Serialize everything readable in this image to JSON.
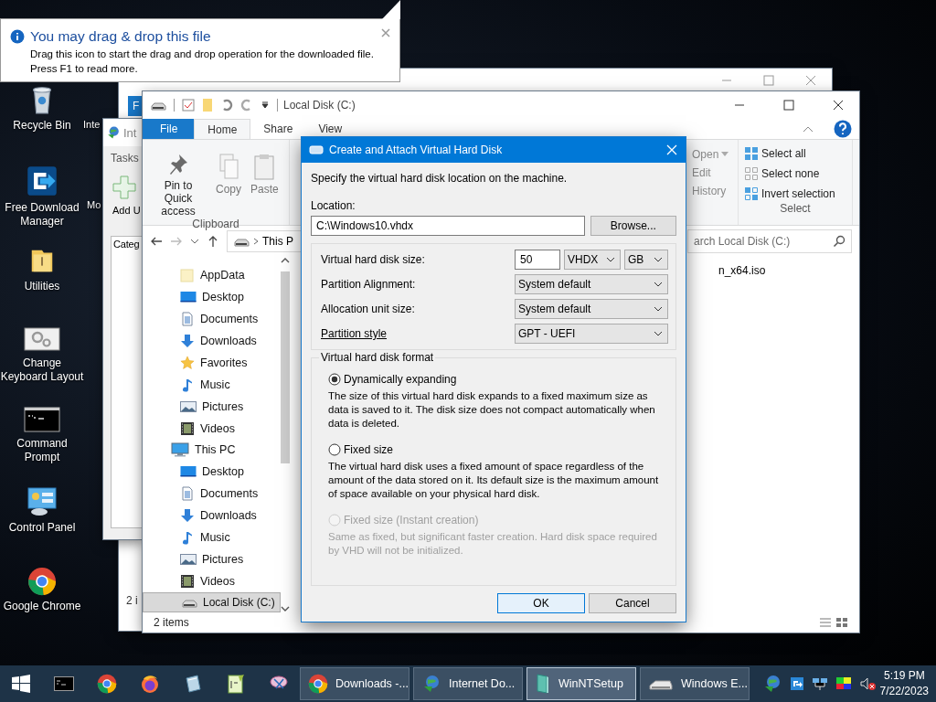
{
  "notification": {
    "title": "You may drag & drop this file",
    "message": "Drag this icon to start the drag and drop operation for the downloaded file.",
    "hint": "Press F1 to read more."
  },
  "desktop_icons": [
    {
      "label": "Recycle Bin",
      "kind": "recycle"
    },
    {
      "label": "Free Download Manager",
      "kind": "fdm"
    },
    {
      "label": "Utilities",
      "kind": "folder"
    },
    {
      "label": "Change Keyboard Layout",
      "kind": "keyboard"
    },
    {
      "label": "Command Prompt",
      "kind": "cmd"
    },
    {
      "label": "Control Panel",
      "kind": "control"
    },
    {
      "label": "Google Chrome",
      "kind": "chrome"
    }
  ],
  "desktop_labels_partial": [
    "Inte",
    "Mo"
  ],
  "back_explorer": {
    "file_tab": "F",
    "status": "2 i"
  },
  "idm_window": {
    "title": "Int",
    "tasks": "Tasks",
    "add_button": "Add U",
    "tree_header": "Categ"
  },
  "explorer": {
    "title": "Local Disk (C:)",
    "tabs": [
      {
        "label": "File",
        "kind": "file",
        "selected": false
      },
      {
        "label": "Home",
        "kind": "tab",
        "selected": true
      },
      {
        "label": "Share",
        "kind": "tab",
        "selected": false
      },
      {
        "label": "View",
        "kind": "tab",
        "selected": false
      }
    ],
    "clipboard": [
      {
        "label": "Pin to Quick access",
        "kind": "pin",
        "disabled": false
      },
      {
        "label": "Copy",
        "kind": "copy",
        "disabled": true
      },
      {
        "label": "Paste",
        "kind": "paste",
        "disabled": true
      }
    ],
    "clipboard_label": "Clipboard",
    "open_items": [
      {
        "label": "Open",
        "kind": "dropdown"
      },
      {
        "label": "Edit",
        "kind": "plain"
      },
      {
        "label": "History",
        "kind": "plain"
      }
    ],
    "select_items": [
      {
        "label": "Select all",
        "kind": "all"
      },
      {
        "label": "Select none",
        "kind": "none"
      },
      {
        "label": "Invert selection",
        "kind": "invert"
      }
    ],
    "select_label": "Select",
    "address": "This P",
    "search_placeholder": "arch Local Disk (C:)",
    "nav_pane": {
      "scrolled_children": [
        {
          "label": "AppData",
          "kind": "appdata",
          "selected": false
        },
        {
          "label": "Desktop",
          "kind": "desktop",
          "selected": false
        },
        {
          "label": "Documents",
          "kind": "documents",
          "selected": false
        },
        {
          "label": "Downloads",
          "kind": "downloads",
          "selected": false
        },
        {
          "label": "Favorites",
          "kind": "favorites",
          "selected": false
        },
        {
          "label": "Music",
          "kind": "music",
          "selected": false
        },
        {
          "label": "Pictures",
          "kind": "pictures",
          "selected": false
        },
        {
          "label": "Videos",
          "kind": "videos",
          "selected": false
        }
      ],
      "this_pc": {
        "label": "This PC",
        "kind": "pc",
        "selected": false,
        "children": [
          {
            "label": "Desktop",
            "kind": "desktop",
            "selected": false
          },
          {
            "label": "Documents",
            "kind": "documents",
            "selected": false
          },
          {
            "label": "Downloads",
            "kind": "downloads",
            "selected": false
          },
          {
            "label": "Music",
            "kind": "music",
            "selected": false
          },
          {
            "label": "Pictures",
            "kind": "pictures",
            "selected": false
          },
          {
            "label": "Videos",
            "kind": "videos",
            "selected": false
          },
          {
            "label": "Local Disk (C:)",
            "kind": "drive",
            "selected": true
          }
        ]
      }
    },
    "files": [
      "n_x64.iso"
    ],
    "status": "2 items"
  },
  "dialog": {
    "title": "Create and Attach Virtual Hard Disk",
    "instruction": "Specify the virtual hard disk location on the machine.",
    "location_label": "Location:",
    "location_value": "C:\\Windows10.vhdx",
    "browse": "Browse...",
    "size_label": "Virtual hard disk size:",
    "size_value": "50",
    "size_type": "VHDX",
    "size_unit": "GB",
    "rows": [
      {
        "label": "Partition Alignment:",
        "value": "System default",
        "kind": "plain"
      },
      {
        "label": "Allocation unit size:",
        "value": "System default",
        "kind": "plain"
      },
      {
        "label": "Partition style",
        "value": "GPT - UEFI",
        "kind": "link"
      }
    ],
    "format_legend": "Virtual hard disk format",
    "formats": [
      {
        "label": "Dynamically expanding",
        "description": "The size of this virtual hard disk expands to a fixed maximum size as data is saved to it. The disk size does not compact automatically when data is deleted.",
        "selected": true,
        "disabled": false
      },
      {
        "label": "Fixed size",
        "description": "The virtual hard disk uses a fixed amount of space regardless of the amount of the data stored on it. Its default size is the maximum amount of space available on your physical hard disk.",
        "selected": false,
        "disabled": false
      },
      {
        "label": "Fixed size (Instant creation)",
        "description": "Same as fixed, but significant faster creation. Hard disk space required by VHD will not be initialized.",
        "selected": false,
        "disabled": true
      }
    ],
    "buttons": [
      {
        "label": "OK",
        "kind": "default"
      },
      {
        "label": "Cancel",
        "kind": "normal"
      }
    ]
  },
  "taskbar": {
    "pinned": [
      {
        "kind": "terminal"
      },
      {
        "kind": "chrome"
      },
      {
        "kind": "firefox"
      },
      {
        "kind": "notepad"
      },
      {
        "kind": "editor"
      },
      {
        "kind": "snip"
      }
    ],
    "tasks": [
      {
        "label": "Downloads -...",
        "kind": "chrome",
        "selected": false
      },
      {
        "label": "Internet Do...",
        "kind": "idm",
        "selected": false
      },
      {
        "label": "WinNTSetup",
        "kind": "winnt",
        "selected": true
      },
      {
        "label": "Windows E...",
        "kind": "drive",
        "selected": false
      }
    ],
    "time": "5:19 PM",
    "date": "7/22/2023"
  }
}
